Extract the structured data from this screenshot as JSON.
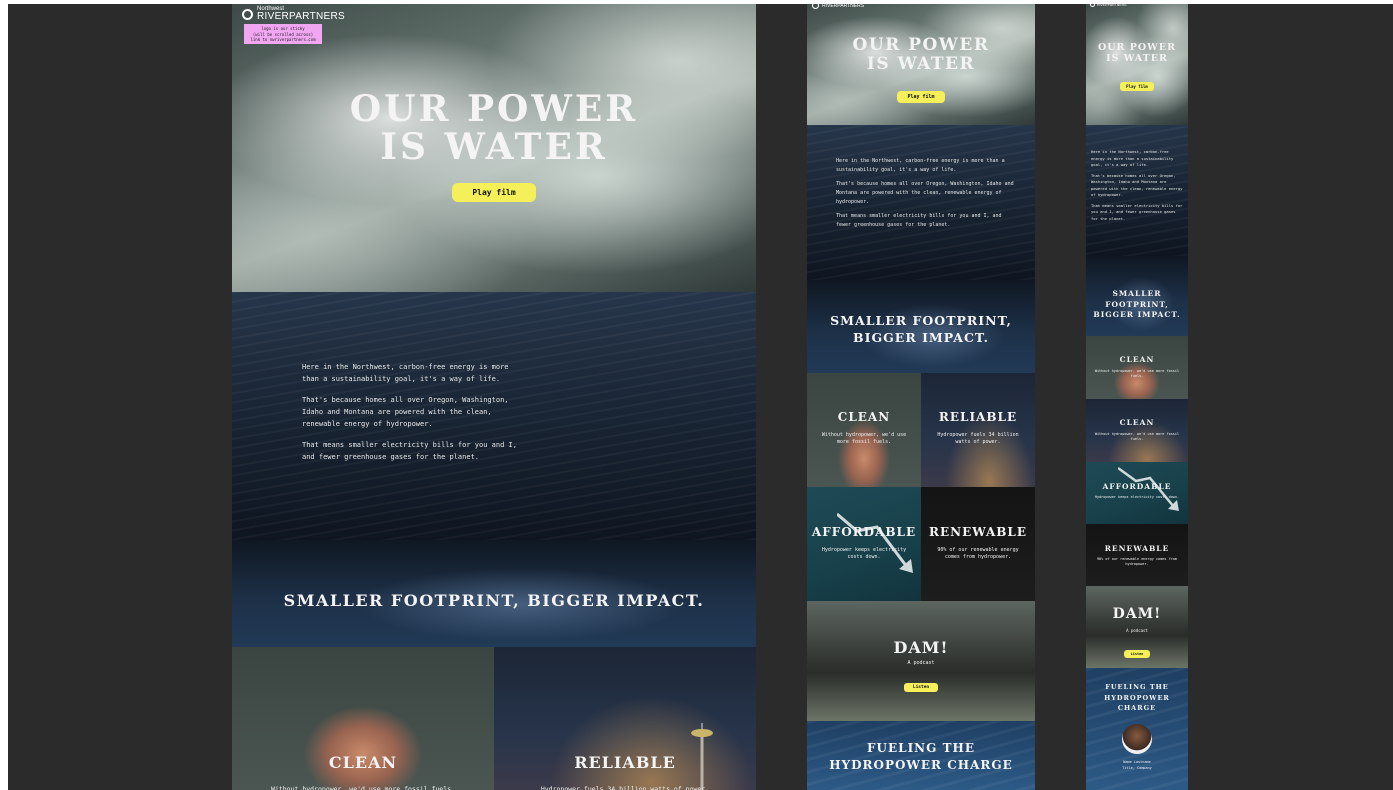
{
  "brand": {
    "prefix": "Northwest",
    "name": "RIVERPARTNERS"
  },
  "sticky_note": {
    "lines": [
      "logo is our sticky",
      "(will be scrolled across)",
      "link to nwriverpartners.com"
    ]
  },
  "hero": {
    "title_line1": "OUR POWER",
    "title_line2": "IS WATER",
    "cta": "Play film"
  },
  "intro": {
    "p1": "Here in the Northwest, carbon-free energy is more than a sustainability goal, it's a way of life.",
    "p2": "That's because homes all over Oregon, Washington, Idaho and Montana are powered with the clean, renewable energy of  hydropower.",
    "p3": "That means smaller electricity bills for you and I, and fewer greenhouse gases for the planet."
  },
  "impact": {
    "title": "SMALLER FOOTPRINT, BIGGER IMPACT.",
    "title_line1": "SMALLER FOOTPRINT,",
    "title_line2": "BIGGER IMPACT.",
    "title_mobile1": "SMALLER",
    "title_mobile2": "FOOTPRINT,",
    "title_mobile3": "BIGGER IMPACT."
  },
  "tiles": {
    "clean": {
      "title": "CLEAN",
      "text": "Without hydropower, we'd use more fossil fuels."
    },
    "reliable": {
      "title": "RELIABLE",
      "text": "Hydropower fuels 34 billion watts of power."
    },
    "affordable": {
      "title": "AFFORDABLE",
      "text": "Hydropower keeps electricity costs down."
    },
    "renewable": {
      "title": "RENEWABLE",
      "text": "90% of our renewable energy comes from hydropower."
    }
  },
  "podcast": {
    "title": "DAM!",
    "subtitle": "A podcast",
    "cta": "Listen"
  },
  "fueling": {
    "line1": "FUELING THE",
    "line2": "HYDROPOWER CHARGE",
    "m1": "FUELING THE",
    "m2": "HYDROPOWER",
    "m3": "CHARGE"
  },
  "person": {
    "name": "Name Lastname",
    "role": "Title, Company"
  },
  "colors": {
    "accent": "#f5f05a",
    "sticky": "#f0a6f0",
    "canvas": "#2b2b2b"
  }
}
